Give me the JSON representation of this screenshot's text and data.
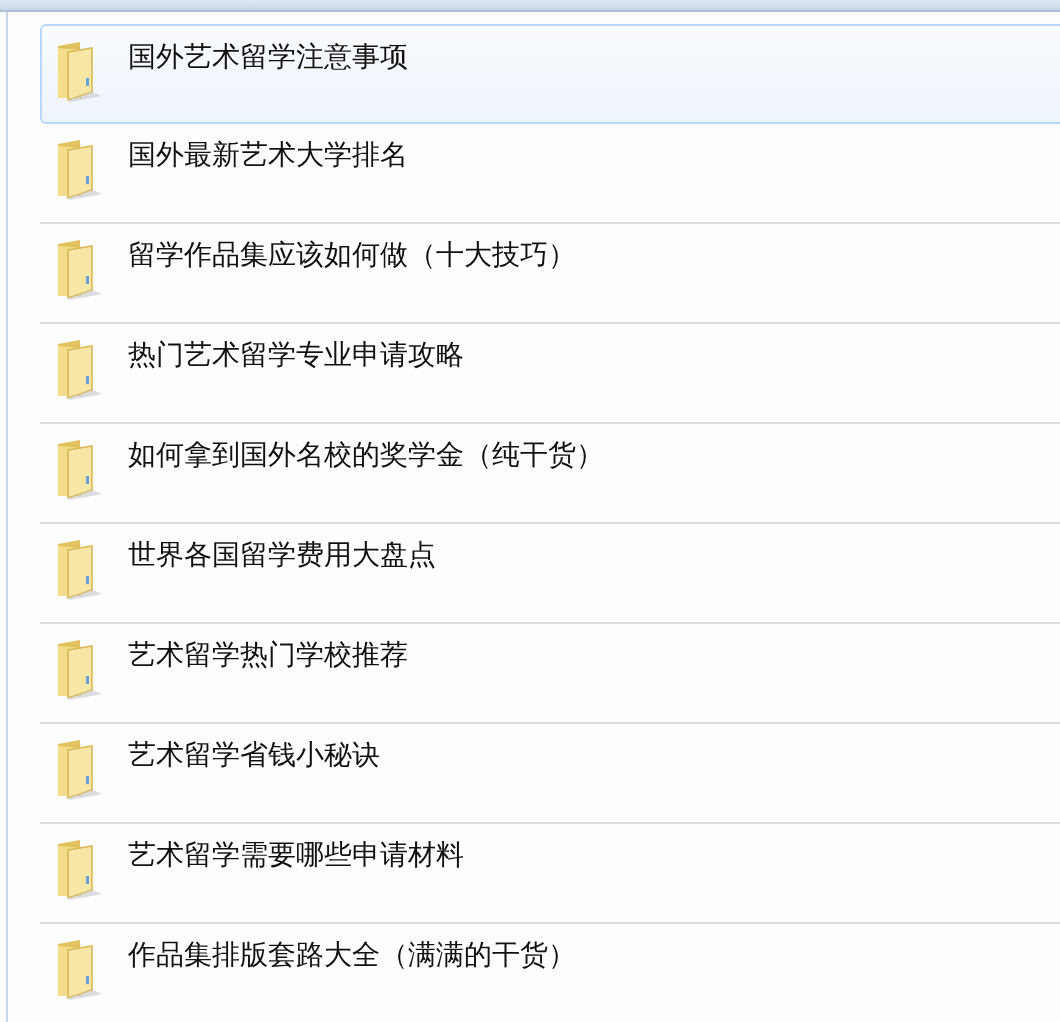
{
  "items": [
    {
      "title": "国外艺术留学注意事项",
      "selected": true
    },
    {
      "title": "国外最新艺术大学排名",
      "selected": false
    },
    {
      "title": "留学作品集应该如何做（十大技巧）",
      "selected": false
    },
    {
      "title": "热门艺术留学专业申请攻略",
      "selected": false
    },
    {
      "title": "如何拿到国外名校的奖学金（纯干货）",
      "selected": false
    },
    {
      "title": "世界各国留学费用大盘点",
      "selected": false
    },
    {
      "title": "艺术留学热门学校推荐",
      "selected": false
    },
    {
      "title": "艺术留学省钱小秘诀",
      "selected": false
    },
    {
      "title": "艺术留学需要哪些申请材料",
      "selected": false
    },
    {
      "title": "作品集排版套路大全（满满的干货）",
      "selected": false
    }
  ]
}
